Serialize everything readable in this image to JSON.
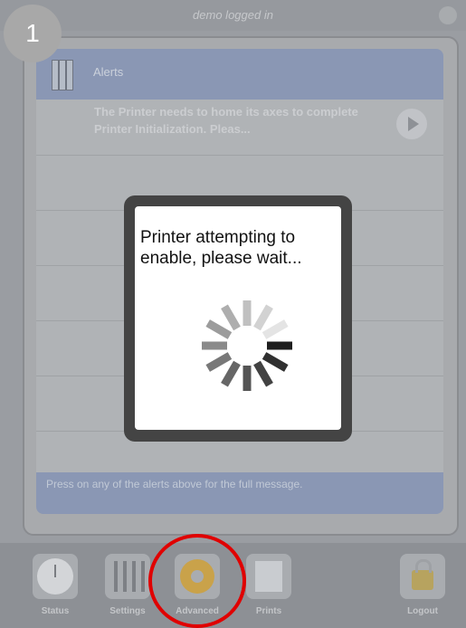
{
  "step_badge": "1",
  "topbar": {
    "status": "demo logged in"
  },
  "alerts": {
    "title": "Alerts",
    "items": [
      {
        "text": "The Printer needs to home its axes to complete Printer Initialization. Pleas..."
      }
    ],
    "footer": "Press on any of the alerts above for the full message."
  },
  "modal": {
    "message": "Printer attempting to enable, please wait..."
  },
  "tabs": [
    {
      "label": "Status",
      "icon": "clock-icon"
    },
    {
      "label": "Settings",
      "icon": "sliders-icon"
    },
    {
      "label": "Advanced",
      "icon": "gear-icon"
    },
    {
      "label": "Prints",
      "icon": "prints-icon"
    },
    {
      "label": "Logout",
      "icon": "lock-icon"
    }
  ],
  "colors": {
    "annotation": "#e00000",
    "header": "#8a97b4"
  }
}
